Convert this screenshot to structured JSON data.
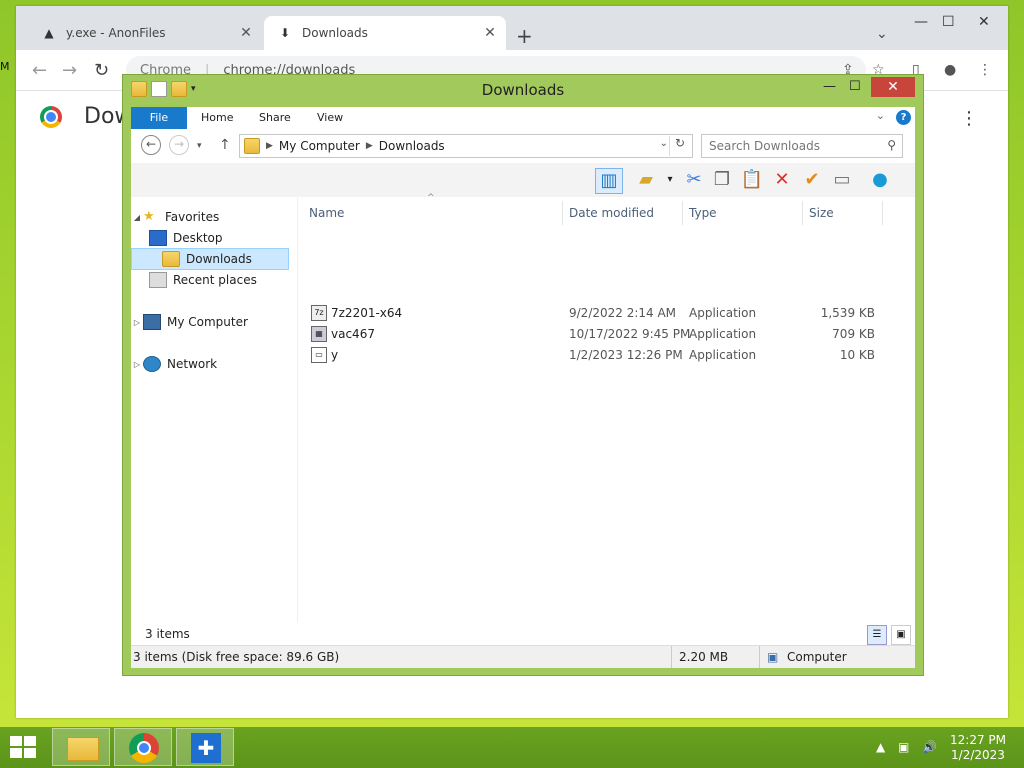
{
  "chrome": {
    "tabs": [
      {
        "label": "y.exe - AnonFiles",
        "icon": "anonfiles-icon"
      },
      {
        "label": "Downloads",
        "icon": "download-icon"
      }
    ],
    "new_tab": "+",
    "omnibox_chip": "Chrome",
    "omnibox_url": "chrome://downloads",
    "page_title": "Dow"
  },
  "explorer": {
    "title": "Downloads",
    "ribbon_tabs": [
      "File",
      "Home",
      "Share",
      "View"
    ],
    "address": [
      "My Computer",
      "Downloads"
    ],
    "search_placeholder": "Search Downloads",
    "nav": {
      "favorites": "Favorites",
      "desktop": "Desktop",
      "downloads": "Downloads",
      "recent": "Recent places",
      "computer": "My Computer",
      "network": "Network"
    },
    "columns": [
      "Name",
      "Date modified",
      "Type",
      "Size"
    ],
    "files": [
      {
        "name": "7z2201-x64",
        "date": "9/2/2022 2:14 AM",
        "type": "Application",
        "size": "1,539 KB"
      },
      {
        "name": "vac467",
        "date": "10/17/2022 9:45 PM",
        "type": "Application",
        "size": "709 KB"
      },
      {
        "name": "y",
        "date": "1/2/2023 12:26 PM",
        "type": "Application",
        "size": "10 KB"
      }
    ],
    "item_count": "3 items",
    "status_left": "3 items (Disk free space: 89.6 GB)",
    "status_size": "2.20 MB",
    "status_location": "Computer"
  },
  "taskbar": {
    "time": "12:27 PM",
    "date": "1/2/2023"
  },
  "colors": {
    "desktop_green": "#a4d42e",
    "explorer_frame": "#a1c95c",
    "file_tab_blue": "#1979ca",
    "close_red": "#c7453b",
    "selection": "#cce8ff"
  }
}
